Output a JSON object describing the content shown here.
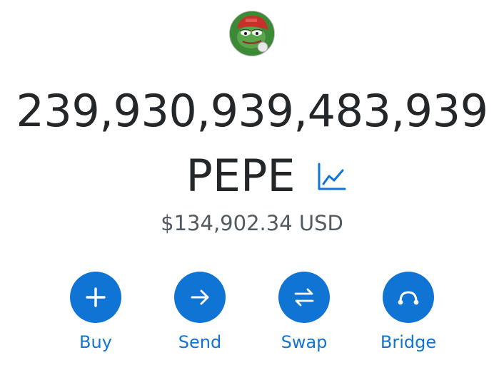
{
  "token": {
    "avatar_icon": "pepe-frog-icon",
    "balance": "239,930,939,483,939",
    "symbol": "PEPE",
    "chart_icon": "line-chart-icon",
    "fiat_value": "$134,902.34 USD"
  },
  "actions": [
    {
      "label": "Buy",
      "icon": "plus-icon"
    },
    {
      "label": "Send",
      "icon": "arrow-right-icon"
    },
    {
      "label": "Swap",
      "icon": "swap-arrows-icon"
    },
    {
      "label": "Bridge",
      "icon": "bridge-icon"
    }
  ],
  "colors": {
    "accent": "#0f74d4",
    "text_primary": "#24272a",
    "text_secondary": "#535a61"
  }
}
